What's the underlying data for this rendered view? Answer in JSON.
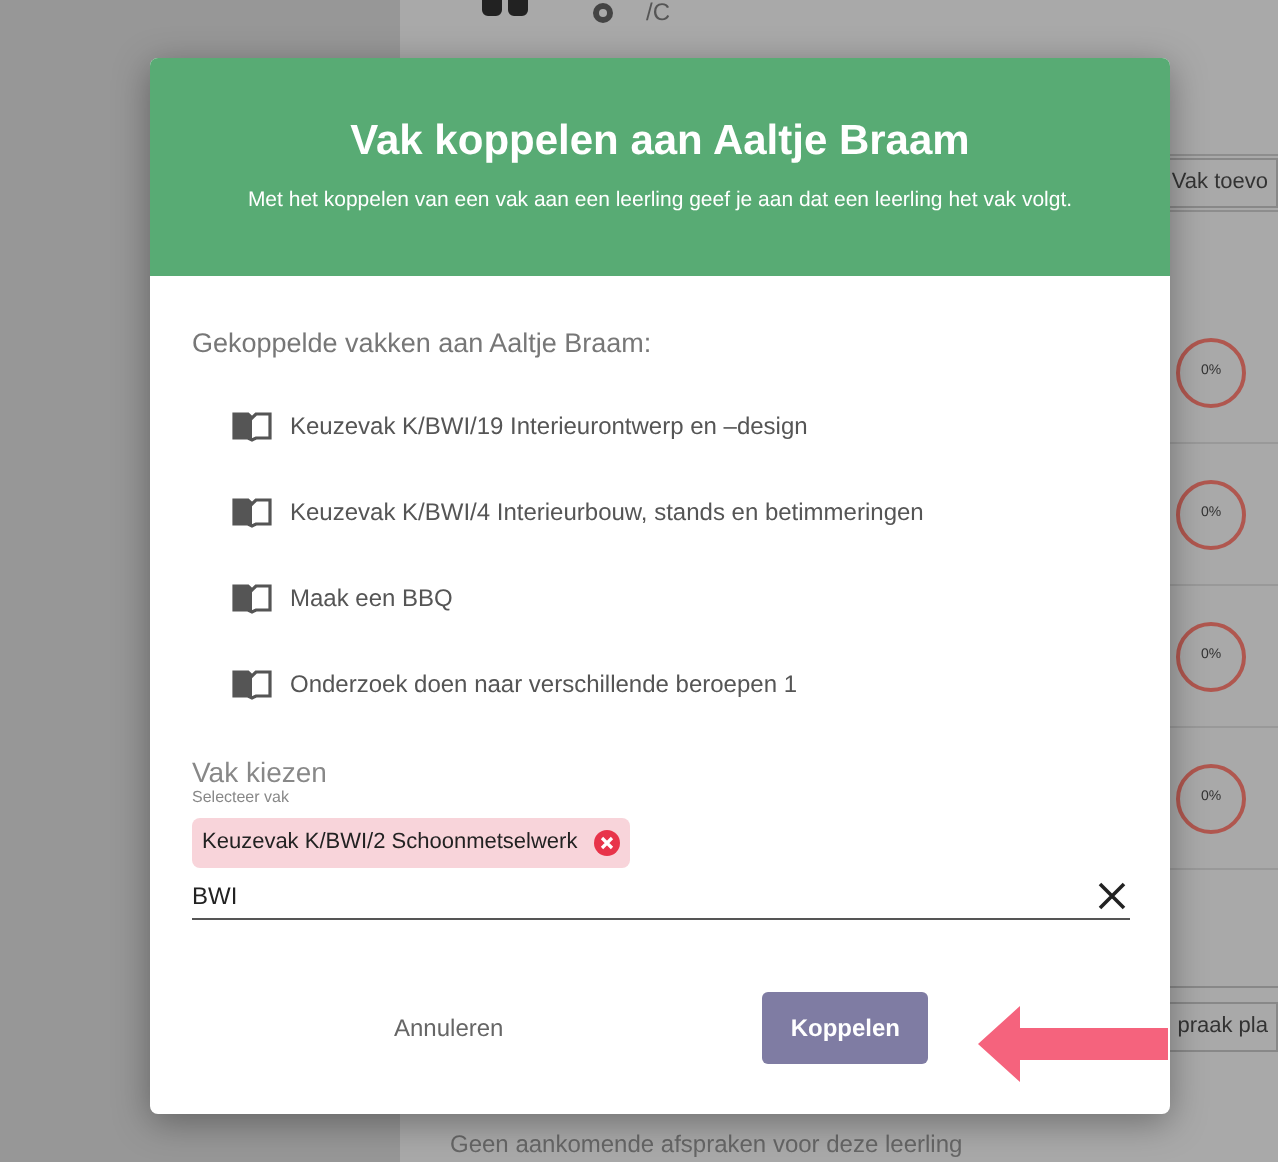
{
  "background": {
    "profile_text": "/C",
    "add_button": "Vak toevo",
    "progress": [
      "0%",
      "0%",
      "0%",
      "0%"
    ],
    "appointment_button": "praak pla",
    "empty_text": "Geen aankomende afspraken voor deze leerling"
  },
  "dialog": {
    "title": "Vak koppelen aan Aaltje Braam",
    "subtitle": "Met het koppelen van een vak aan een leerling geef je aan dat een leerling het vak volgt.",
    "linked_heading": "Gekoppelde vakken aan Aaltje Braam:",
    "linked_subjects": [
      "Keuzevak K/BWI/19 Interieurontwerp en –design",
      "Keuzevak K/BWI/4 Interieurbouw, stands en betimmeringen",
      "Maak een BBQ",
      "Onderzoek doen naar verschillende beroepen 1"
    ],
    "field": {
      "label": "Vak kiezen",
      "hint": "Selecteer vak",
      "chips": [
        "Keuzevak K/BWI/2 Schoonmetselwerk"
      ],
      "value": "BWI"
    },
    "buttons": [
      {
        "kind": "text",
        "label": "Annuleren"
      },
      {
        "kind": "primary",
        "label": "Koppelen"
      }
    ]
  }
}
